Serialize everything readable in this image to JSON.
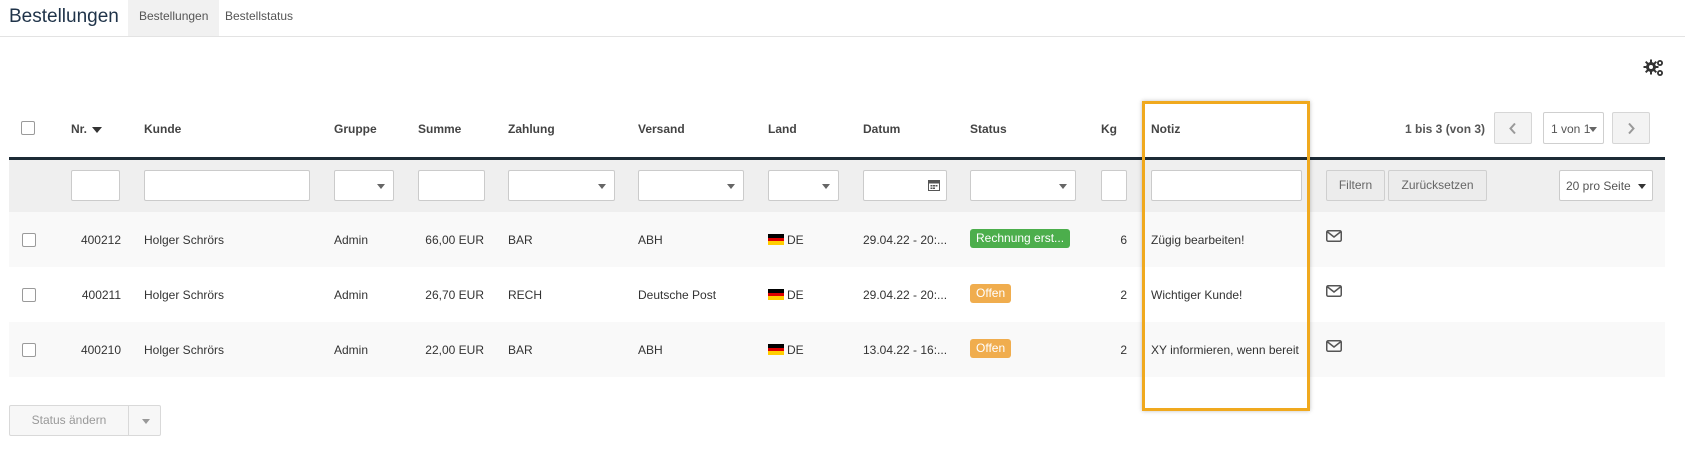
{
  "header": {
    "title": "Bestellungen",
    "tabs": [
      {
        "label": "Bestellungen",
        "active": true
      },
      {
        "label": "Bestellstatus",
        "active": false
      }
    ]
  },
  "table": {
    "columns": {
      "nr": "Nr.",
      "kunde": "Kunde",
      "gruppe": "Gruppe",
      "summe": "Summe",
      "zahlung": "Zahlung",
      "versand": "Versand",
      "land": "Land",
      "datum": "Datum",
      "status": "Status",
      "kg": "Kg",
      "notiz": "Notiz"
    },
    "rows": [
      {
        "nr": "400212",
        "kunde": "Holger Schrörs",
        "gruppe": "Admin",
        "summe": "66,00 EUR",
        "zahlung": "BAR",
        "versand": "ABH",
        "land": "DE",
        "datum": "29.04.22 - 20:...",
        "status": "Rechnung erst...",
        "status_color": "#4cae4c",
        "kg": "6",
        "notiz": "Zügig bearbeiten!"
      },
      {
        "nr": "400211",
        "kunde": "Holger Schrörs",
        "gruppe": "Admin",
        "summe": "26,70 EUR",
        "zahlung": "RECH",
        "versand": "Deutsche Post",
        "land": "DE",
        "datum": "29.04.22 - 20:...",
        "status": "Offen",
        "status_color": "#f0ad4e",
        "kg": "2",
        "notiz": "Wichtiger Kunde!"
      },
      {
        "nr": "400210",
        "kunde": "Holger Schrörs",
        "gruppe": "Admin",
        "summe": "22,00 EUR",
        "zahlung": "BAR",
        "versand": "ABH",
        "land": "DE",
        "datum": "13.04.22 - 16:...",
        "status": "Offen",
        "status_color": "#f0ad4e",
        "kg": "2",
        "notiz": "XY informieren, wenn bereit"
      }
    ]
  },
  "pagination": {
    "info": "1 bis 3 (von 3)",
    "page_select": "1 von 1",
    "per_page": "20 pro Seite"
  },
  "filter": {
    "filter_label": "Filtern",
    "reset_label": "Zurücksetzen"
  },
  "footer": {
    "status_button": "Status ändern"
  },
  "colors": {
    "highlight": "#f0a91e",
    "header_line": "#1d2b36",
    "badge_green": "#4cae4c",
    "badge_orange": "#f0ad4e"
  },
  "icons": [
    "gear-icon",
    "sort-desc-icon",
    "chevron-left-icon",
    "chevron-right-icon",
    "calendar-icon",
    "mail-icon",
    "flag-de-icon"
  ]
}
